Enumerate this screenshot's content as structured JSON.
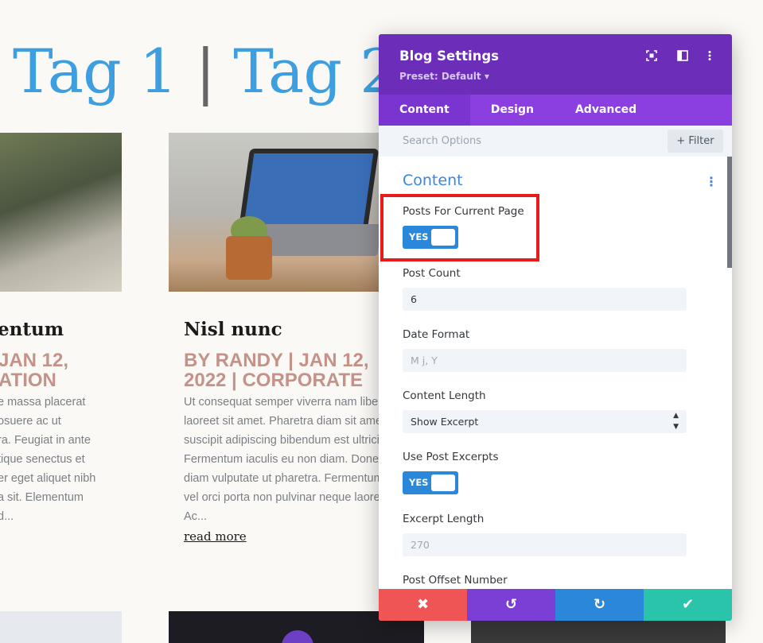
{
  "page": {
    "heading_tag1": "Tag 1",
    "heading_sep": "|",
    "heading_tag2": "Tag 2",
    "posts": [
      {
        "title": "entum",
        "meta": "JAN 12,\nATION",
        "excerpt": "e massa placerat\nosuere ac ut\nra. Feugiat in ante\ntique senectus et\ner eget aliquet nibh\na sit. Elementum\nd..."
      },
      {
        "title": "Nisl nunc",
        "meta": "BY RANDY | JAN 12,\n2022 | CORPORATE",
        "excerpt": "Ut consequat semper viverra nam libero\nlaoreet sit amet. Pharetra diam sit amet\nsuscipit adipiscing bibendum est ultricie\nFermentum iaculis eu non diam. Donec\ndiam vulputate ut pharetra. Fermentum\nvel orci porta non pulvinar neque laoree\nAc...",
        "read_more": "read more"
      }
    ]
  },
  "modal": {
    "title": "Blog Settings",
    "preset": "Preset: Default ▾",
    "header_icons": [
      "fullscreen-icon",
      "columns-icon",
      "more-vertical-icon"
    ],
    "tabs": [
      "Content",
      "Design",
      "Advanced"
    ],
    "active_tab": "Content",
    "search_placeholder": "Search Options",
    "filter_label": "+ Filter",
    "group_title": "Content",
    "fields": {
      "posts_for_current_page": {
        "label": "Posts For Current Page",
        "toggle": "YES"
      },
      "post_count": {
        "label": "Post Count",
        "value": "6"
      },
      "date_format": {
        "label": "Date Format",
        "placeholder": "M j, Y"
      },
      "content_length": {
        "label": "Content Length",
        "value": "Show Excerpt"
      },
      "use_post_excerpts": {
        "label": "Use Post Excerpts",
        "toggle": "YES"
      },
      "excerpt_length": {
        "label": "Excerpt Length",
        "placeholder": "270"
      },
      "post_offset": {
        "label": "Post Offset Number"
      }
    },
    "footer": {
      "cancel": "✖",
      "undo": "↺",
      "redo": "↻",
      "save": "✔"
    },
    "colors": {
      "header": "#6c2eb9",
      "tabs": "#8b3fe0",
      "toggle": "#2b87da",
      "cancel": "#ef5555",
      "undo": "#7c3fd6",
      "redo": "#2b87da",
      "save": "#29c4a9",
      "highlight": "#e61c1c"
    }
  }
}
